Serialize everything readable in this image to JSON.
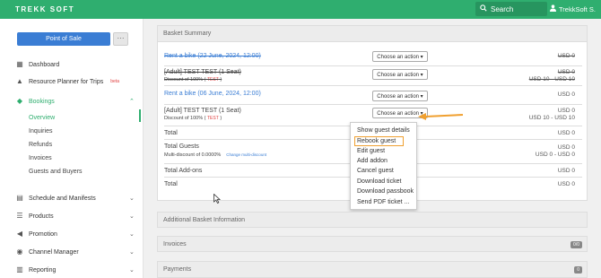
{
  "topbar": {
    "logo_text": "TREKK SOFT",
    "search_label": "Search",
    "user_label": "TrekkSoft S.",
    "color": "#2fae6f"
  },
  "sidebar": {
    "pos_button": "Point of Sale",
    "more_button": "···",
    "items": [
      {
        "label": "Dashboard",
        "icon": "dashboard-icon"
      },
      {
        "label": "Resource Planner for Trips",
        "badge": "beta",
        "icon": "road-icon"
      },
      {
        "label": "Bookings",
        "icon": "tag-icon"
      },
      {
        "label": "Schedule and Manifests",
        "icon": "calendar-icon"
      },
      {
        "label": "Products",
        "icon": "list-icon"
      },
      {
        "label": "Promotion",
        "icon": "bullhorn-icon"
      },
      {
        "label": "Channel Manager",
        "icon": "globe-icon"
      },
      {
        "label": "Reporting",
        "icon": "chart-icon"
      }
    ],
    "sub_items": [
      "Overview",
      "Inquiries",
      "Refunds",
      "Invoices",
      "Guests and Buyers"
    ]
  },
  "basket": {
    "title": "Basket Summary",
    "rows": [
      {
        "label": "Rent a bike (22 June, 2024, 12:00)",
        "action": "Choose an action ▾",
        "price": "USD 0"
      },
      {
        "label": "[Adult] TEST TEST (1 Seat)",
        "discount": "Discount of 100% (",
        "tag": "TEST",
        "discount_end": ")",
        "action": "Choose an action ▾",
        "price": "USD 0",
        "price2": "USD 10 - USD 10"
      },
      {
        "label": "Rent a bike (06 June, 2024, 12:00)",
        "action": "Choose an action ▾",
        "price": "USD 0"
      },
      {
        "label": "[Adult] TEST TEST (1 Seat)",
        "discount": "Discount of 100% (",
        "tag": "TEST",
        "discount_end": ")",
        "action": "Choose an action ▾",
        "price": "USD 0",
        "price2": "USD 10 - USD 10"
      }
    ],
    "total_label": "Total",
    "total_price": "USD 0",
    "guests_label": "Total Guests",
    "multi_discount": "Multi-discount of 0.0000%",
    "change_discount": "Change multi-discount",
    "guests_price": "USD 0",
    "guests_price2": "USD 0 - USD 0",
    "addons_label": "Total Add-ons",
    "addons_price": "USD 0",
    "final_total_label": "Total",
    "final_total_price": "USD 0"
  },
  "action_menu": {
    "items": [
      "Show guest details",
      "Rebook guest",
      "Edit guest",
      "Add addon",
      "Cancel guest",
      "Download ticket",
      "Download passbook",
      "Send PDF ticket ..."
    ],
    "highlight_color": "#f0a030"
  },
  "panels": {
    "additional": "Additional Basket Information",
    "invoices": "Invoices",
    "invoices_badge": "0/0",
    "payments": "Payments",
    "payments_badge": "0"
  }
}
